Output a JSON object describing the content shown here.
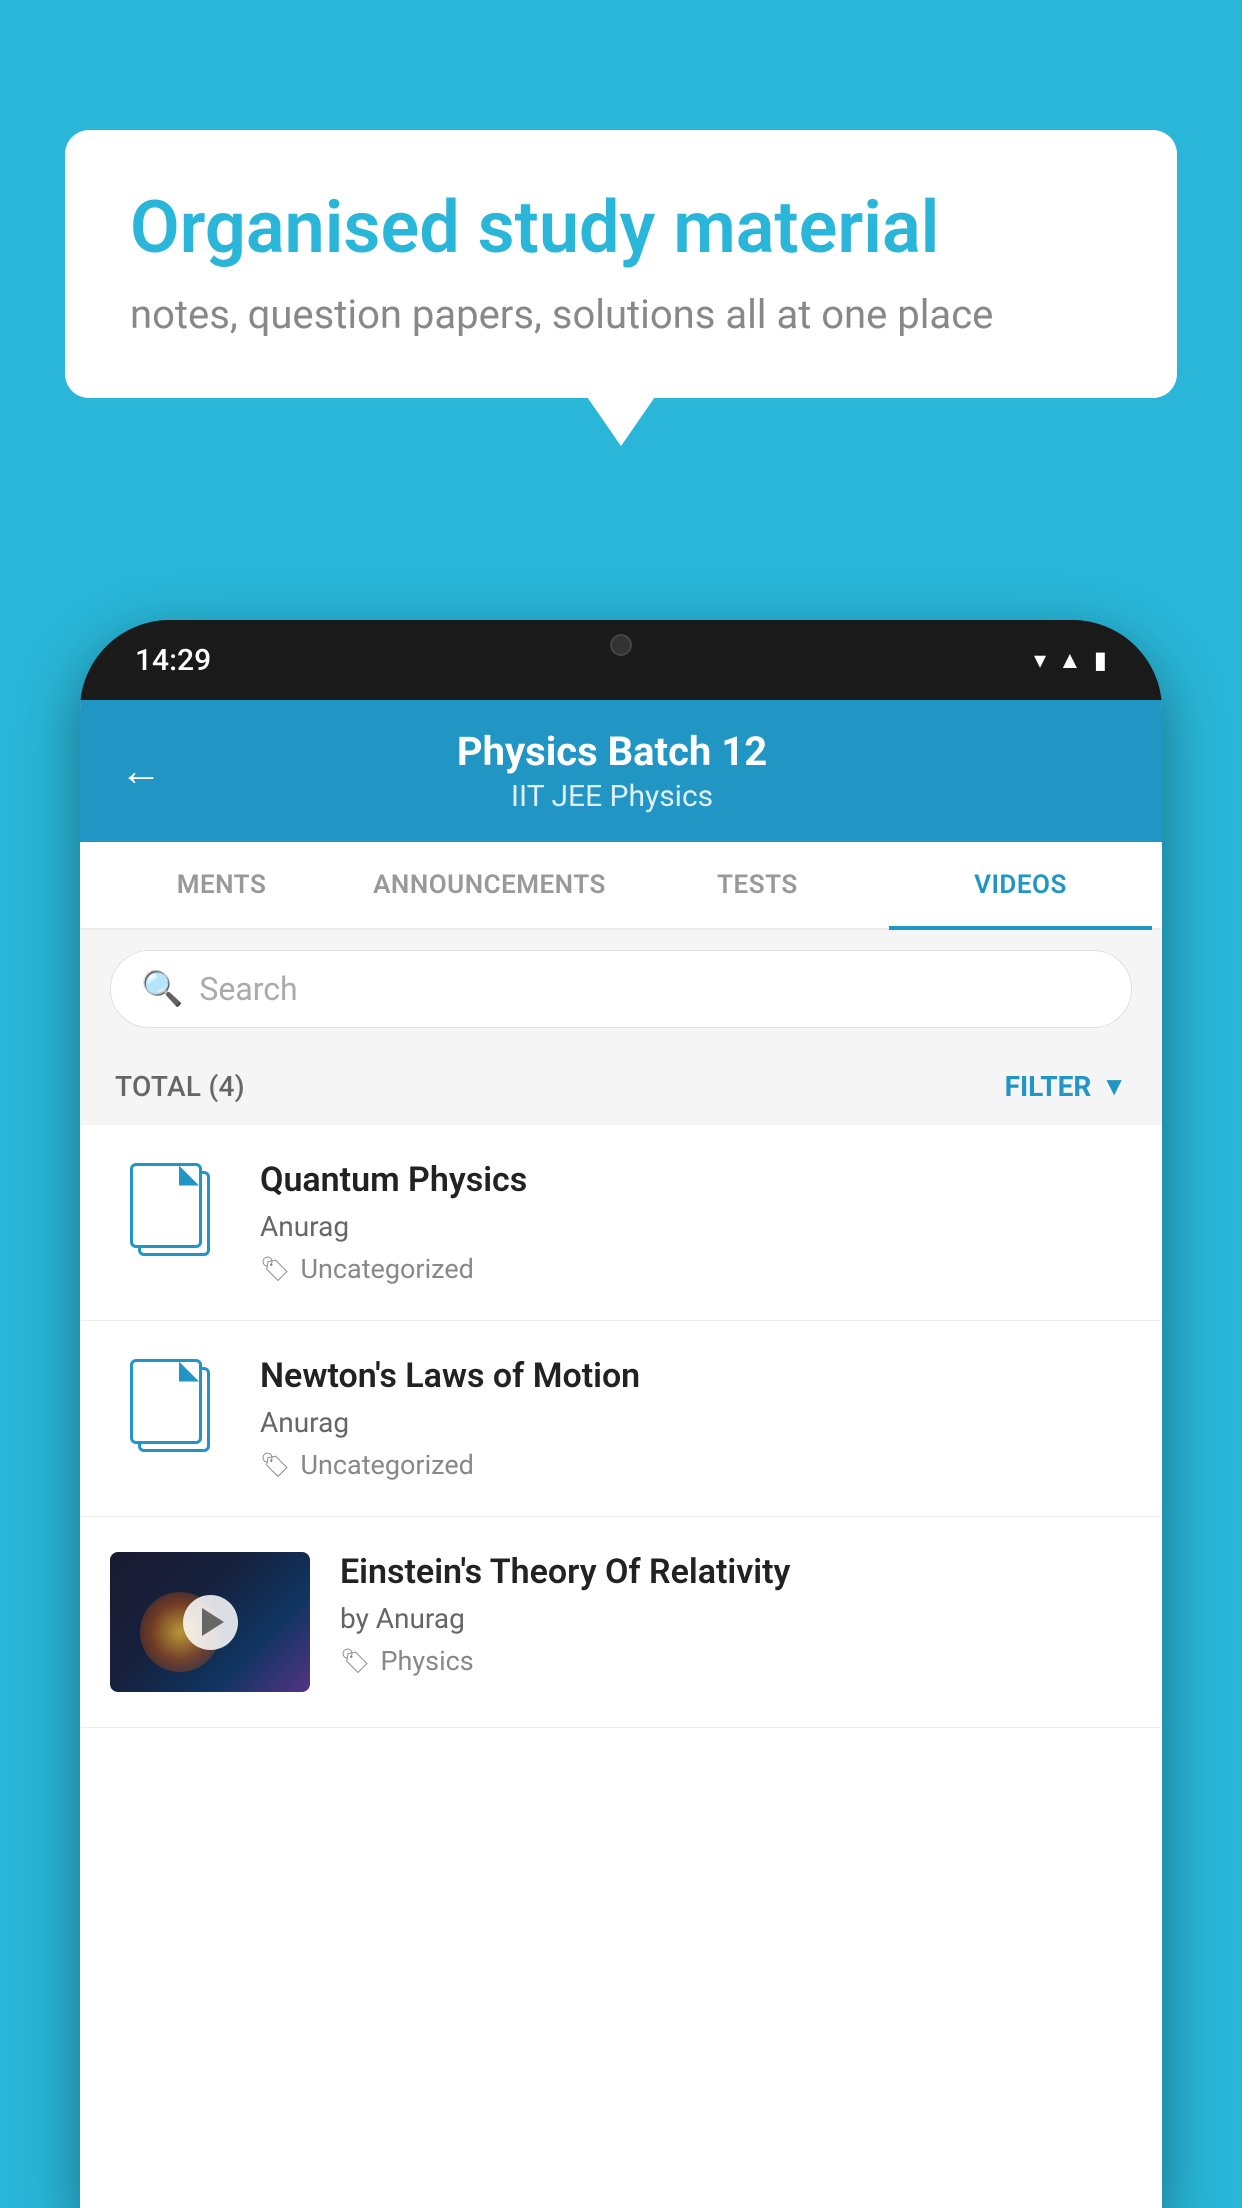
{
  "background_color": "#29b6d8",
  "speech_bubble": {
    "heading": "Organised study material",
    "subtext": "notes, question papers, solutions all at one place"
  },
  "phone": {
    "status_bar": {
      "time": "14:29"
    },
    "header": {
      "title": "Physics Batch 12",
      "subtitle": "IIT JEE   Physics",
      "back_label": "←"
    },
    "tabs": [
      {
        "label": "MENTS",
        "active": false
      },
      {
        "label": "ANNOUNCEMENTS",
        "active": false
      },
      {
        "label": "TESTS",
        "active": false
      },
      {
        "label": "VIDEOS",
        "active": true
      }
    ],
    "search": {
      "placeholder": "Search"
    },
    "filter_row": {
      "total_label": "TOTAL (4)",
      "filter_label": "FILTER"
    },
    "videos": [
      {
        "title": "Quantum Physics",
        "author": "Anurag",
        "tag": "Uncategorized",
        "has_thumbnail": false
      },
      {
        "title": "Newton's Laws of Motion",
        "author": "Anurag",
        "tag": "Uncategorized",
        "has_thumbnail": false
      },
      {
        "title": "Einstein's Theory Of Relativity",
        "author": "by Anurag",
        "tag": "Physics",
        "has_thumbnail": true
      }
    ]
  }
}
